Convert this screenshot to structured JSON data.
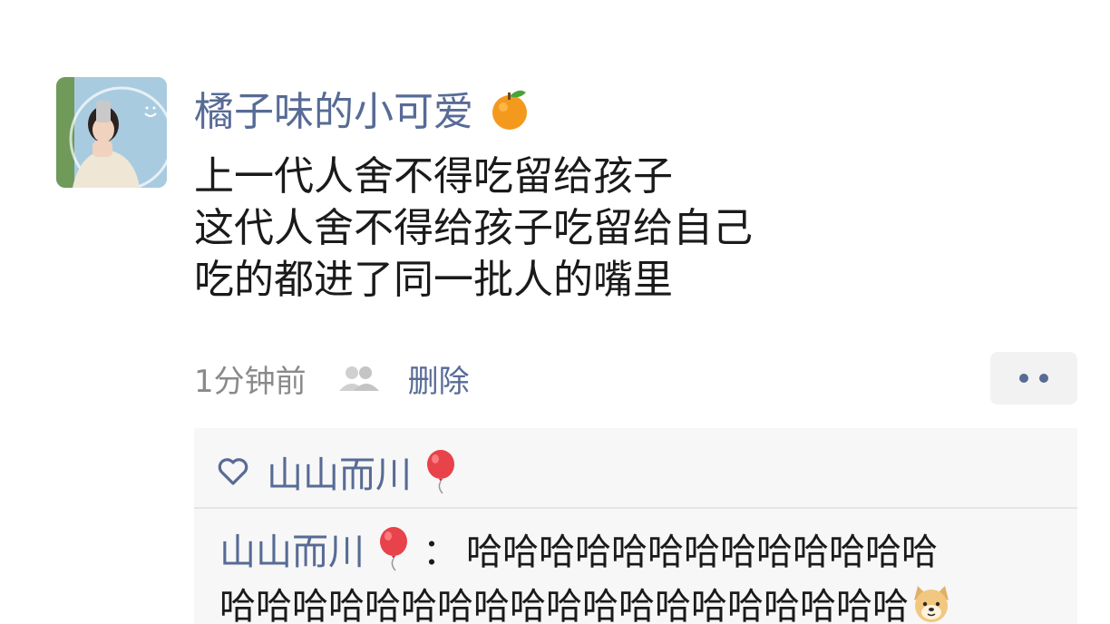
{
  "post": {
    "author": "橘子味的小可爱",
    "author_emoji": "orange-icon",
    "lines": [
      "上一代人舍不得吃留给孩子",
      "这代人舍不得给孩子吃留给自己",
      "吃的都进了同一批人的嘴里"
    ],
    "time": "1分钟前",
    "visibility_icon": "friends-icon",
    "delete_label": "删除",
    "more_icon": "more-dots-icon"
  },
  "likes": {
    "icon": "heart-icon",
    "names": [
      "山山而川"
    ],
    "name_emoji": "balloon-icon"
  },
  "comments": [
    {
      "author": "山山而川",
      "author_emoji": "balloon-icon",
      "separator": "：",
      "text_line1": "哈哈哈哈哈哈哈哈哈哈哈哈哈",
      "text_line2": "哈哈哈哈哈哈哈哈哈哈哈哈哈哈哈哈哈哈哈",
      "trailing_emoji": "doge-icon"
    }
  ],
  "colors": {
    "link_blue": "#576b95",
    "text_dark": "#1a1a1a",
    "meta_gray": "#8a8a8a",
    "comment_bg": "#f7f7f7"
  }
}
